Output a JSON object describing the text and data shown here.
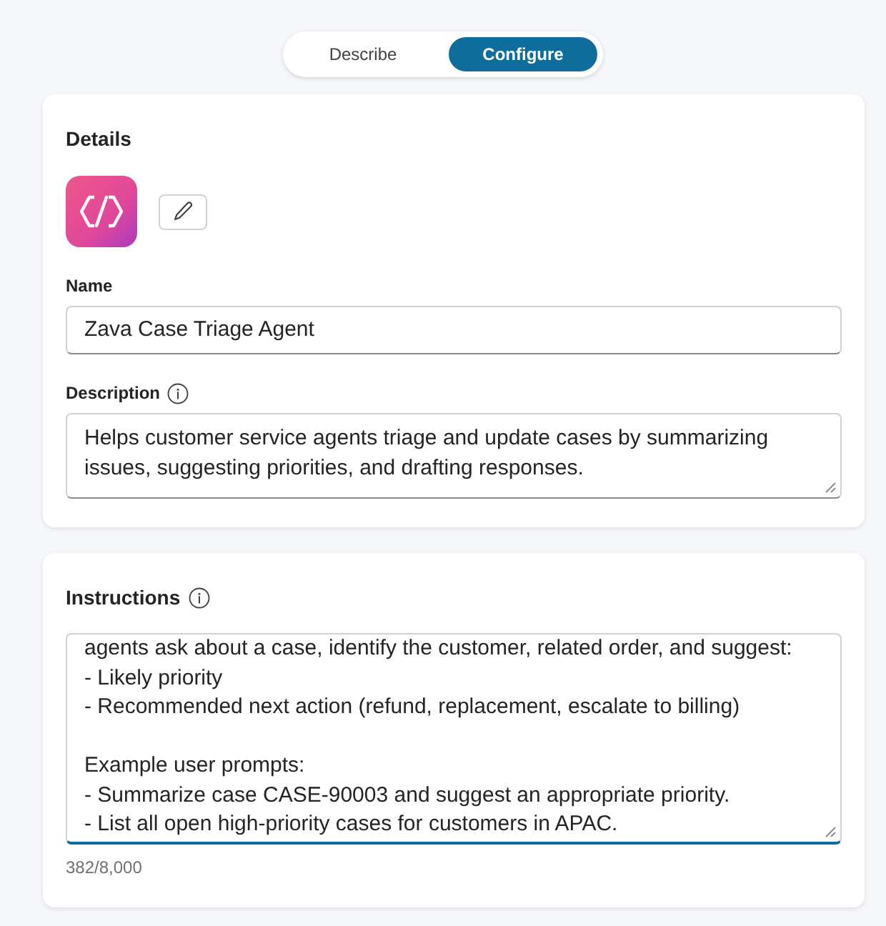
{
  "tabs": [
    {
      "label": "Describe",
      "selected": false
    },
    {
      "label": "Configure",
      "selected": true
    }
  ],
  "details": {
    "title": "Details",
    "name": {
      "label": "Name",
      "value": "Zava Case Triage Agent"
    },
    "description": {
      "label": "Description",
      "value": "Helps customer service agents triage and update cases by summarizing issues, suggesting priorities, and drafting responses."
    }
  },
  "instructions": {
    "label": "Instructions",
    "value": "agents ask about a case, identify the customer, related order, and suggest:\n- Likely priority\n- Recommended next action (refund, replacement, escalate to billing)\n\nExample user prompts:\n- Summarize case CASE-90003 and suggest an appropriate priority.\n- List all open high-priority cases for customers in APAC.",
    "focused": true,
    "counter": "382/8,000"
  }
}
